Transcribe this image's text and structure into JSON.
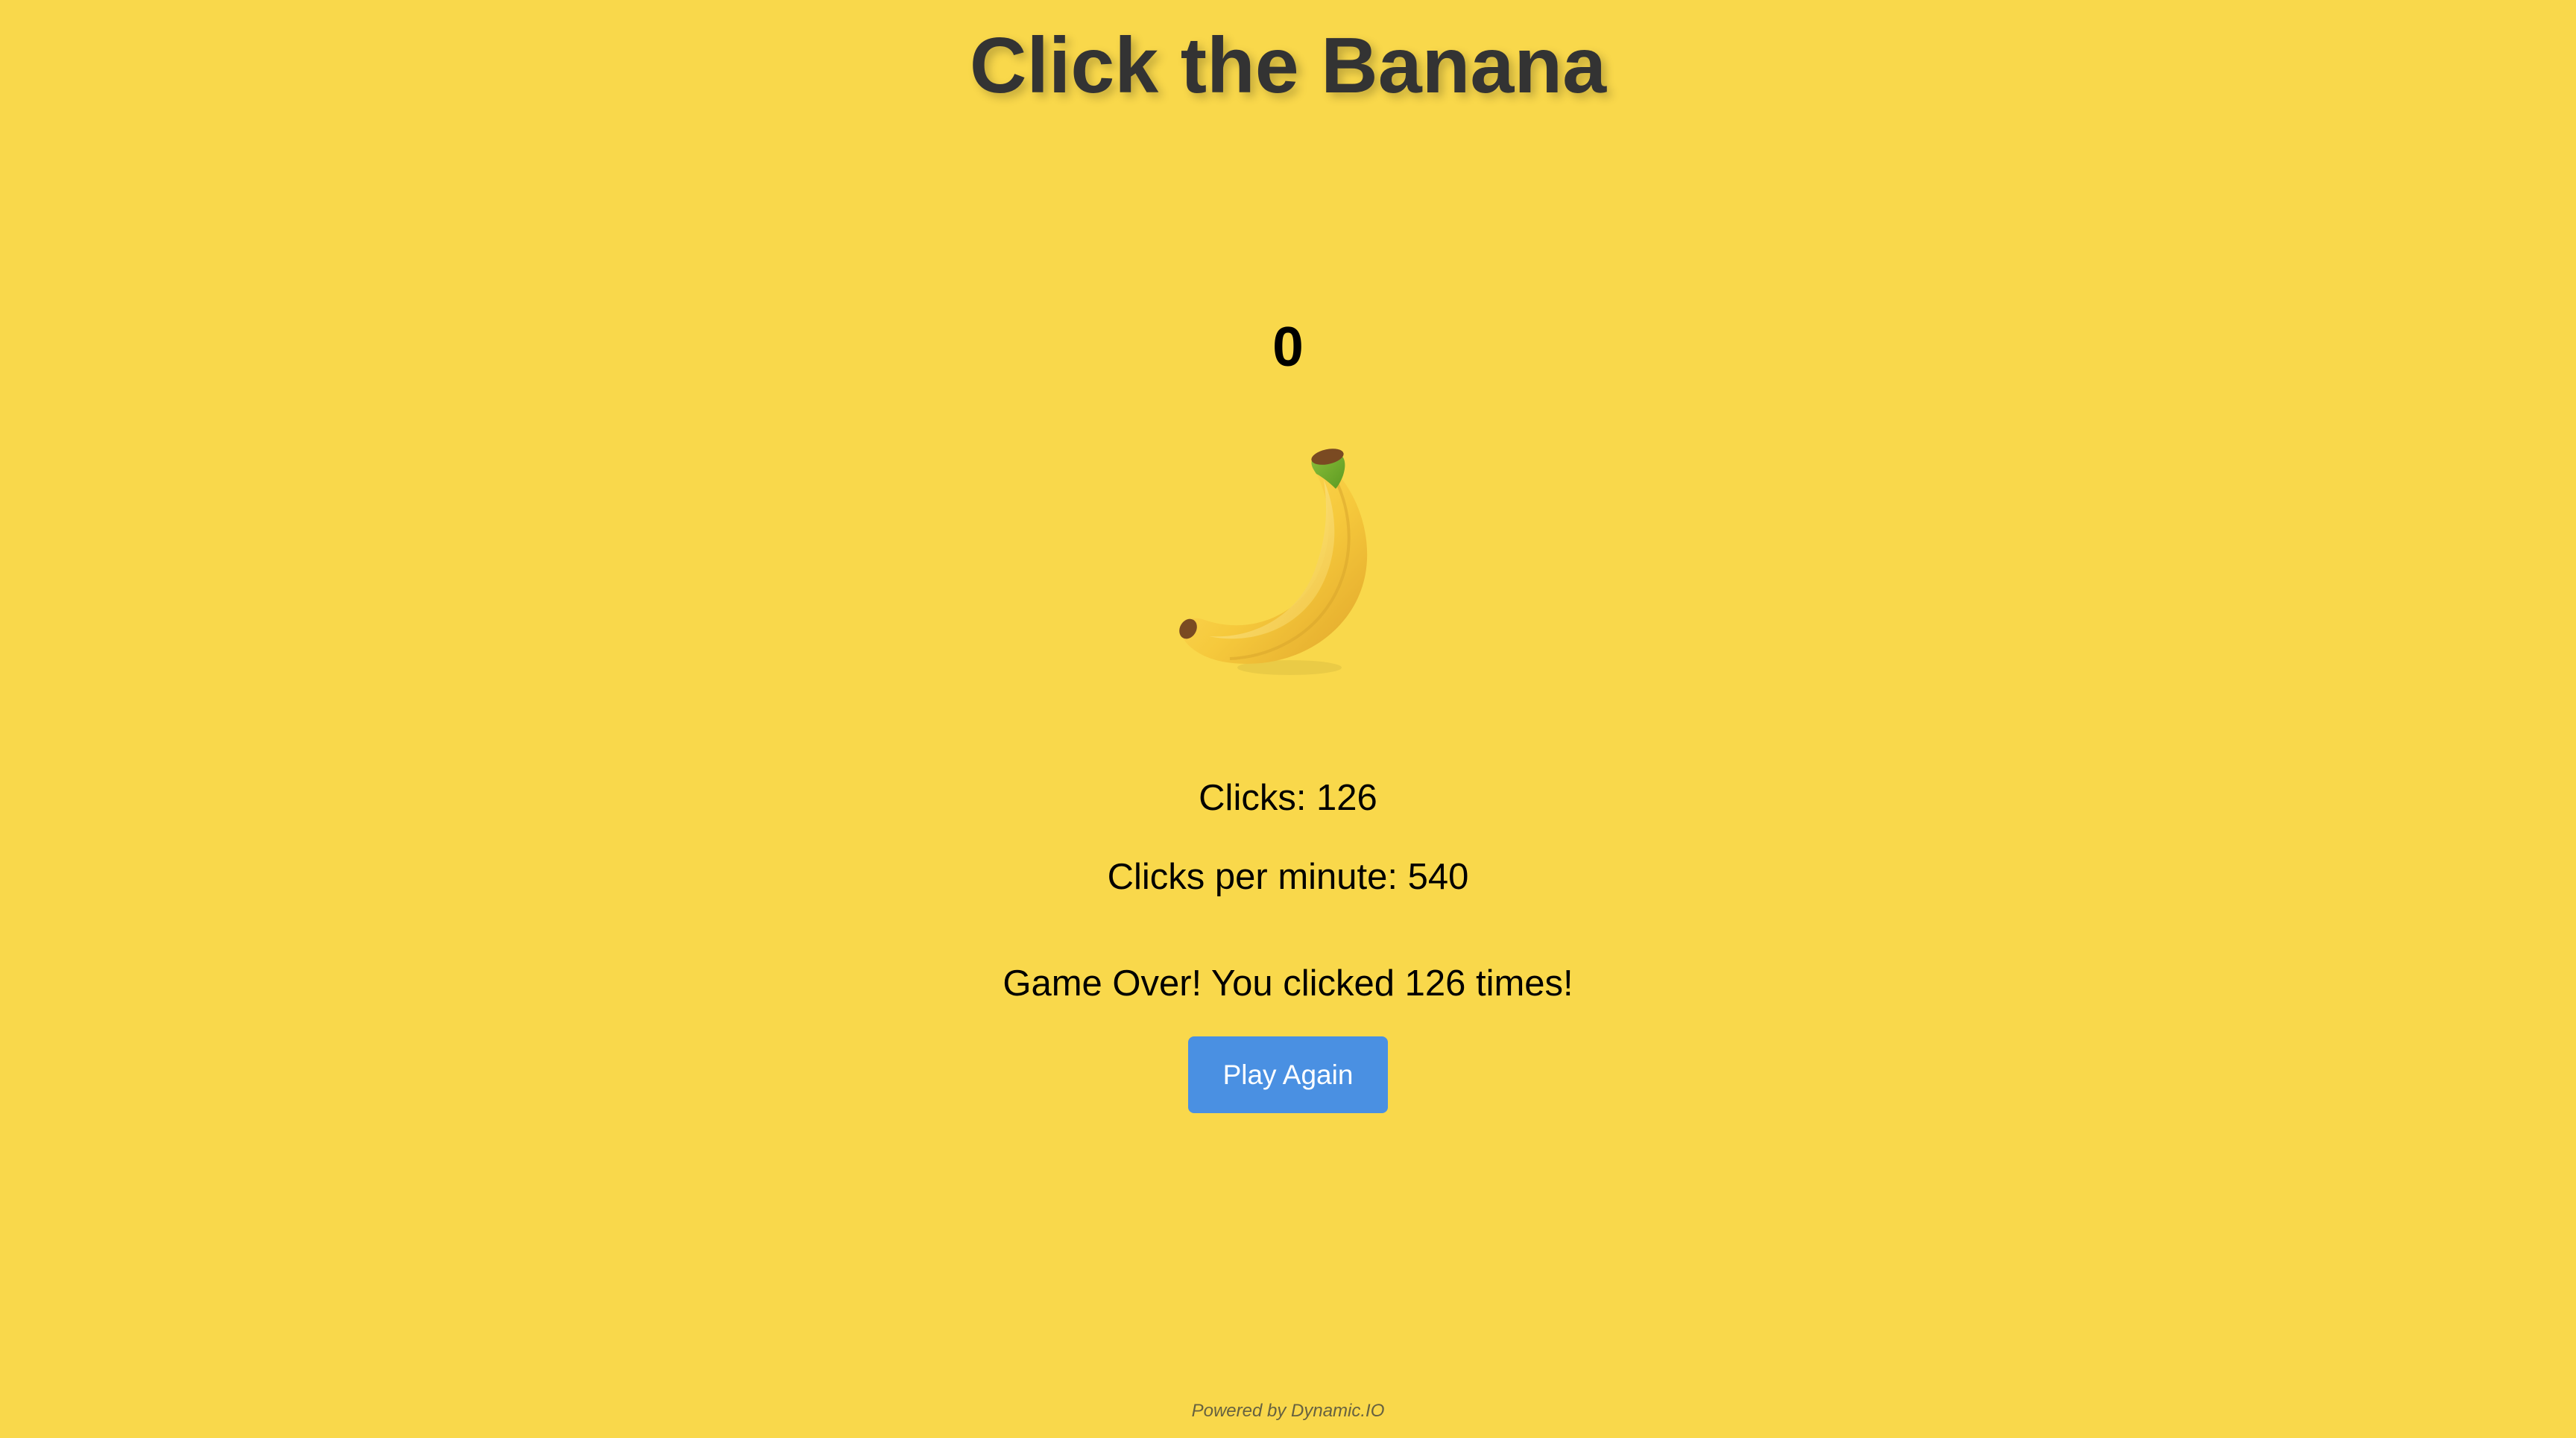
{
  "page": {
    "title": "Click the Banana",
    "background_color": "#f9d84b"
  },
  "game": {
    "timer_value": "0",
    "banana_icon": "banana-icon",
    "clicks_text": "Clicks: 126",
    "clicks_per_minute_text": "Clicks per minute: 540",
    "game_over_text": "Game Over! You clicked 126 times!",
    "play_again_label": "Play Again",
    "play_again_color": "#4a90e2"
  },
  "footer": {
    "powered_by": "Powered by Dynamic.IO"
  }
}
